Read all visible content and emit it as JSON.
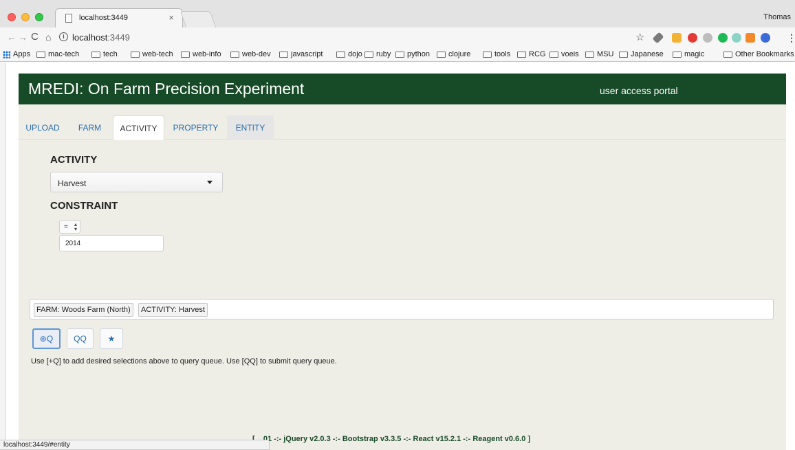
{
  "browser": {
    "tab_title": "localhost:3449",
    "tab_close": "×",
    "profile": "Thomas",
    "url_host": "localhost",
    "url_port": ":3449",
    "nav": {
      "back": "←",
      "forward": "→",
      "reload": "C",
      "home": "⌂"
    },
    "star": "☆",
    "menu": "⋮",
    "info": "i"
  },
  "bookmarks": {
    "apps": "Apps",
    "items": [
      "mac-tech",
      "tech",
      "web-tech",
      "web-info",
      "web-dev",
      "javascript",
      "dojo",
      "ruby",
      "python",
      "clojure",
      "tools",
      "RCG",
      "voeis",
      "MSU",
      "Japanese",
      "magic"
    ],
    "other": "Other Bookmarks"
  },
  "header": {
    "title": "MREDI: On Farm Precision Experiment",
    "portal": "user access portal"
  },
  "tabs": [
    {
      "label": "UPLOAD",
      "state": "normal"
    },
    {
      "label": "FARM",
      "state": "normal"
    },
    {
      "label": "ACTIVITY",
      "state": "active"
    },
    {
      "label": "PROPERTY",
      "state": "normal"
    },
    {
      "label": "ENTITY",
      "state": "hover"
    }
  ],
  "activity": {
    "heading": "ACTIVITY",
    "selected": "Harvest"
  },
  "constraint": {
    "heading": "CONSTRAINT",
    "operator": "=",
    "value": "2014"
  },
  "query": {
    "chips": [
      "FARM: Woods Farm (North)",
      "ACTIVITY: Harvest"
    ]
  },
  "buttons": {
    "add_query": "⊕Q",
    "submit_queue": "QQ",
    "favorite": "★"
  },
  "help_text": "Use [+Q] to add desired selections above to query queue. Use [QQ] to submit query queue.",
  "footer": "[ ...01 -:- jQuery v2.0.3 -:- Bootstrap v3.3.5 -:- React v15.2.1 -:- Reagent v0.6.0 ]",
  "status_url": "localhost:3449/#entity",
  "colors": {
    "header_bg": "#174a27",
    "page_bg": "#eeede6",
    "link": "#2a6db0"
  }
}
